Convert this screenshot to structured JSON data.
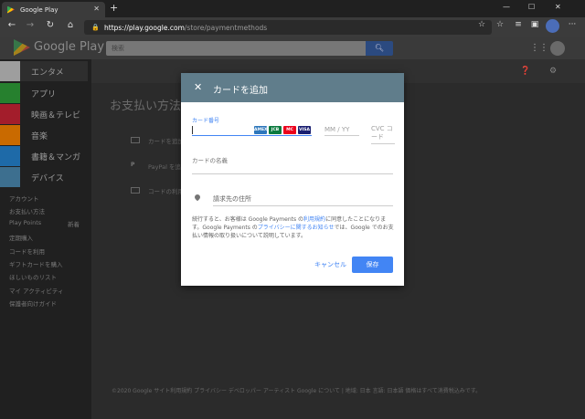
{
  "browser": {
    "tab_title": "Google Play",
    "url_host": "https://play.google.com",
    "url_path": "/store/paymentmethods"
  },
  "play": {
    "logo_text": "Google Play",
    "search_placeholder": "検索",
    "categories": [
      {
        "label": "エンタメ",
        "color": "#d0d0d0"
      },
      {
        "label": "アプリ",
        "color": "#26802e"
      },
      {
        "label": "映画＆テレビ",
        "color": "#a31d2b"
      },
      {
        "label": "音楽",
        "color": "#c96a00"
      },
      {
        "label": "書籍＆マンガ",
        "color": "#1e6aa8"
      },
      {
        "label": "デバイス",
        "color": "#3d6f8f"
      }
    ],
    "side_links": [
      "アカウント",
      "お支払い方法",
      "Play Points",
      "定期購入",
      "コードを利用",
      "ギフトカードを購入",
      "ほしいものリスト",
      "マイ アクティビティ",
      "保護者向けガイド"
    ],
    "play_points_badge": "新着",
    "page_title": "お支払い方法",
    "payment_rows": [
      "カードを追加",
      "PayPal を追加",
      "コードの利用"
    ],
    "footer": "©2020 Google  サイト利用規約  プライバシー  デベロッパー  アーティスト  Google について | 地域: 日本  言語: 日本語    価格はすべて消費税込みです。"
  },
  "dialog": {
    "title": "カードを追加",
    "card_number_label": "カード番号",
    "card_brands": [
      "AMEX",
      "JCB",
      "MC",
      "VISA"
    ],
    "expiry_placeholder": "MM / YY",
    "cvc_placeholder": "CVC コード",
    "name_placeholder": "カードの名義",
    "billing_placeholder": "請求先の住所",
    "terms_part1": "続行すると、お客様は Google Payments の",
    "terms_link1": "利用規約",
    "terms_part2": "に同意したことになります。Google Payments の",
    "terms_link2": "プライバシーに関するお知らせ",
    "terms_part3": "では、Google でのお支払い情報の取り扱いについて説明しています。",
    "cancel_label": "キャンセル",
    "save_label": "保存"
  }
}
